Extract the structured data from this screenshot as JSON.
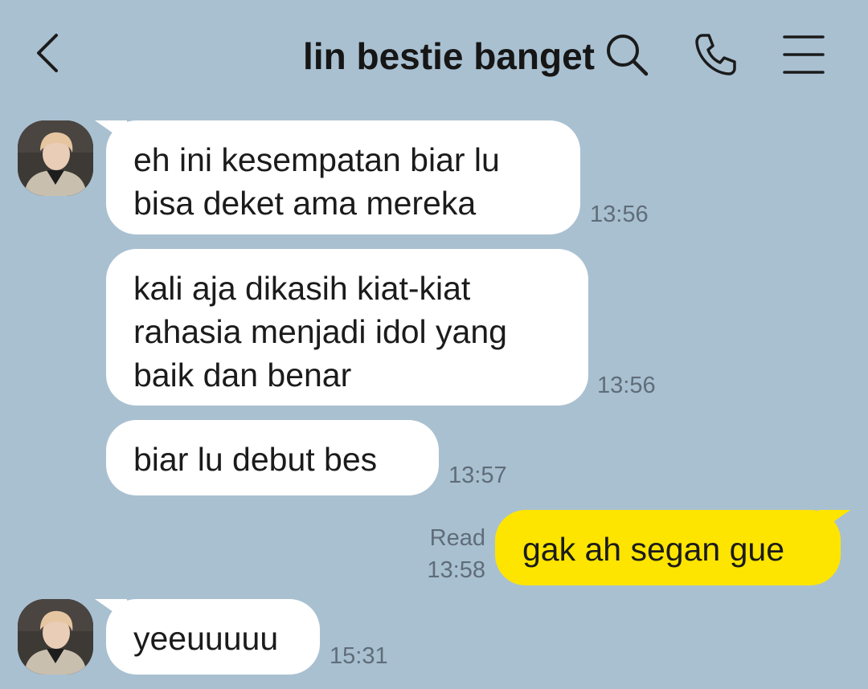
{
  "header": {
    "title": "lin bestie banget",
    "back_icon": "chevron-left-icon",
    "search_icon": "search-icon",
    "call_icon": "phone-icon",
    "menu_icon": "menu-icon"
  },
  "colors": {
    "background": "#a9c0d1",
    "incoming_bubble": "#ffffff",
    "outgoing_bubble": "#fee500",
    "timestamp": "#5f6d79"
  },
  "messages": [
    {
      "sender": "them",
      "text": "eh ini kesempatan biar lu\nbisa deket ama mereka",
      "time": "13:56"
    },
    {
      "sender": "them",
      "text": "kali aja dikasih kiat-kiat\nrahasia menjadi idol yang\nbaik dan benar",
      "time": "13:56"
    },
    {
      "sender": "them",
      "text": "biar lu debut bes",
      "time": "13:57"
    },
    {
      "sender": "me",
      "text": "gak ah segan gue",
      "read": "Read",
      "time": "13:58"
    },
    {
      "sender": "them",
      "text": "yeeuuuuu",
      "time": "15:31"
    }
  ]
}
